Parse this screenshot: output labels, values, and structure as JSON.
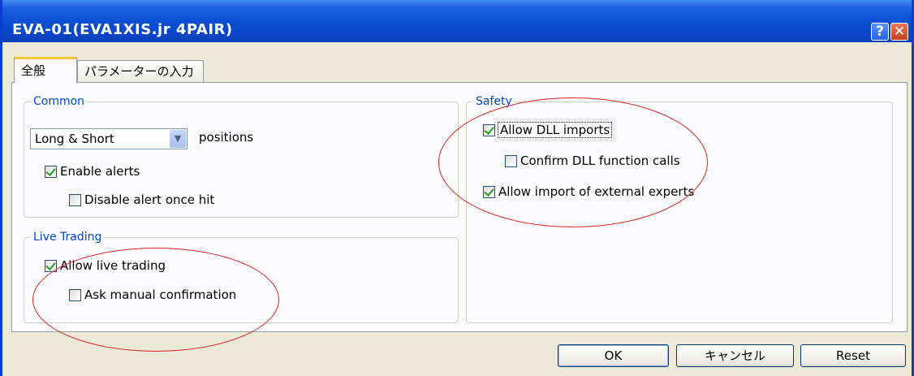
{
  "window": {
    "title": "EVA-01(EVA1XIS.jr 4PAIR)",
    "help_glyph": "?",
    "close_glyph": "✕"
  },
  "tabs": [
    {
      "label": "全般",
      "active": true
    },
    {
      "label": "パラメーターの入力",
      "active": false
    }
  ],
  "common": {
    "label": "Common",
    "positions_select": {
      "value": "Long & Short",
      "suffix": "positions"
    },
    "enable_alerts": {
      "label": "Enable alerts",
      "checked": true
    },
    "disable_alert_once_hit": {
      "label": "Disable alert once hit",
      "checked": false
    }
  },
  "live_trading": {
    "label": "Live Trading",
    "allow_live_trading": {
      "label": "Allow live trading",
      "checked": true
    },
    "ask_manual_confirmation": {
      "label": "Ask manual confirmation",
      "checked": false
    }
  },
  "safety": {
    "label": "Safety",
    "allow_dll_imports": {
      "label": "Allow DLL imports",
      "checked": true
    },
    "confirm_dll_function_calls": {
      "label": "Confirm DLL function calls",
      "checked": false
    },
    "allow_import_external_experts": {
      "label": "Allow import of external experts",
      "checked": true
    }
  },
  "buttons": {
    "ok": "OK",
    "cancel": "キャンセル",
    "reset": "Reset"
  },
  "colors": {
    "titlebar": "#0a4fd4",
    "group_label": "#0046d5",
    "annotation": "#e02020"
  }
}
